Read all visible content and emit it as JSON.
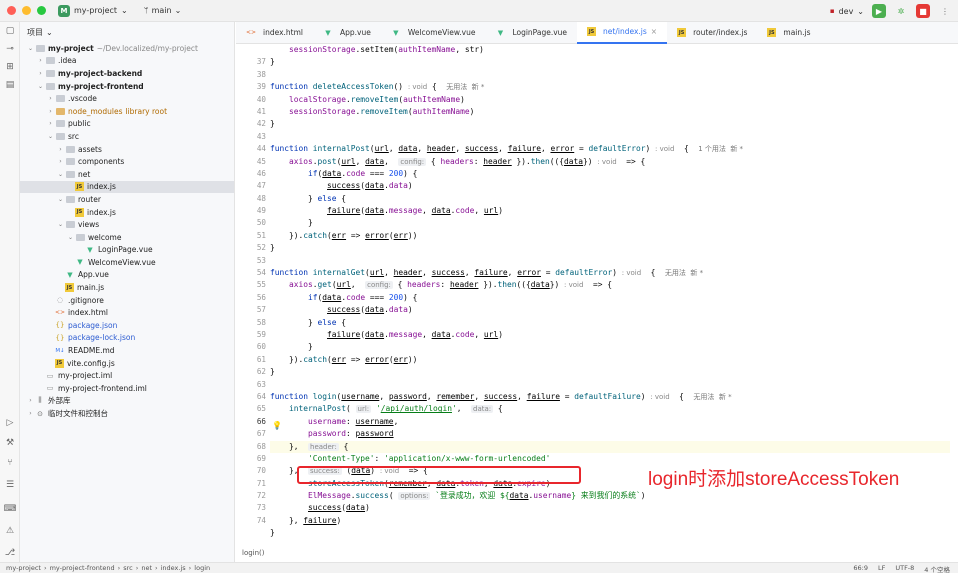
{
  "titlebar": {
    "project_badge": "M",
    "project_name": "my-project",
    "branch": "main",
    "run_config": "dev"
  },
  "sidebar": {
    "header": "项目",
    "tree": [
      {
        "depth": 0,
        "arrow": "v",
        "icon": "folder",
        "label": "my-project",
        "suffix": "~/Dev.localized/my-project",
        "bold": true
      },
      {
        "depth": 1,
        "arrow": ">",
        "icon": "folder",
        "label": ".idea"
      },
      {
        "depth": 1,
        "arrow": ">",
        "icon": "folder",
        "label": "my-project-backend",
        "bold": true
      },
      {
        "depth": 1,
        "arrow": "v",
        "icon": "folder",
        "label": "my-project-frontend",
        "bold": true
      },
      {
        "depth": 2,
        "arrow": ">",
        "icon": "folder",
        "label": ".vscode"
      },
      {
        "depth": 2,
        "arrow": ">",
        "icon": "folder-orange",
        "label": "node_modules",
        "suffix": "library root",
        "orange": true
      },
      {
        "depth": 2,
        "arrow": ">",
        "icon": "folder",
        "label": "public"
      },
      {
        "depth": 2,
        "arrow": "v",
        "icon": "folder",
        "label": "src"
      },
      {
        "depth": 3,
        "arrow": ">",
        "icon": "folder",
        "label": "assets"
      },
      {
        "depth": 3,
        "arrow": ">",
        "icon": "folder",
        "label": "components"
      },
      {
        "depth": 3,
        "arrow": "v",
        "icon": "folder",
        "label": "net"
      },
      {
        "depth": 4,
        "arrow": "",
        "icon": "js",
        "label": "index.js",
        "selected": true
      },
      {
        "depth": 3,
        "arrow": "v",
        "icon": "folder",
        "label": "router"
      },
      {
        "depth": 4,
        "arrow": "",
        "icon": "js",
        "label": "index.js"
      },
      {
        "depth": 3,
        "arrow": "v",
        "icon": "folder",
        "label": "views"
      },
      {
        "depth": 4,
        "arrow": "v",
        "icon": "folder",
        "label": "welcome"
      },
      {
        "depth": 5,
        "arrow": "",
        "icon": "vue",
        "label": "LoginPage.vue"
      },
      {
        "depth": 4,
        "arrow": "",
        "icon": "vue",
        "label": "WelcomeView.vue"
      },
      {
        "depth": 3,
        "arrow": "",
        "icon": "vue",
        "label": "App.vue"
      },
      {
        "depth": 3,
        "arrow": "",
        "icon": "js",
        "label": "main.js"
      },
      {
        "depth": 2,
        "arrow": "",
        "icon": "git",
        "label": ".gitignore"
      },
      {
        "depth": 2,
        "arrow": "",
        "icon": "html",
        "label": "index.html"
      },
      {
        "depth": 2,
        "arrow": "",
        "icon": "json",
        "label": "package.json",
        "blue": true
      },
      {
        "depth": 2,
        "arrow": "",
        "icon": "json",
        "label": "package-lock.json",
        "blue": true
      },
      {
        "depth": 2,
        "arrow": "",
        "icon": "md",
        "label": "README.md"
      },
      {
        "depth": 2,
        "arrow": "",
        "icon": "js",
        "label": "vite.config.js"
      },
      {
        "depth": 1,
        "arrow": "",
        "icon": "iml",
        "label": "my-project.iml"
      },
      {
        "depth": 1,
        "arrow": "",
        "icon": "iml",
        "label": "my-project-frontend.iml"
      },
      {
        "depth": 0,
        "arrow": ">",
        "icon": "lib",
        "label": "外部库"
      },
      {
        "depth": 0,
        "arrow": ">",
        "icon": "scratch",
        "label": "临时文件和控制台"
      }
    ]
  },
  "tabs": [
    {
      "label": "index.html",
      "icon": "html",
      "active": false
    },
    {
      "label": "App.vue",
      "icon": "vue",
      "active": false
    },
    {
      "label": "WelcomeView.vue",
      "icon": "vue",
      "active": false
    },
    {
      "label": "LoginPage.vue",
      "icon": "vue",
      "active": false
    },
    {
      "label": "net/index.js",
      "icon": "js",
      "active": true
    },
    {
      "label": "router/index.js",
      "icon": "js",
      "active": false
    },
    {
      "label": "main.js",
      "icon": "js",
      "active": false
    }
  ],
  "editor": {
    "line_numbers": [
      "",
      "37",
      "38",
      "39",
      "40",
      "41",
      "42",
      "43",
      "44",
      "45",
      "46",
      "47",
      "48",
      "49",
      "50",
      "51",
      "52",
      "53",
      "54",
      "55",
      "56",
      "57",
      "58",
      "59",
      "60",
      "61",
      "62",
      "63",
      "64",
      "65",
      "66",
      "67",
      "68",
      "69",
      "70",
      "71",
      "72",
      "73",
      "74"
    ],
    "annotation": "login时添加storeAccessToken",
    "function_breadcrumb": "login()"
  },
  "statusbar": {
    "path": [
      "my-project",
      "my-project-frontend",
      "src",
      "net",
      "index.js",
      "login"
    ],
    "position": "66:9",
    "line_sep": "LF",
    "encoding": "UTF-8",
    "indent": "4 个空格"
  }
}
